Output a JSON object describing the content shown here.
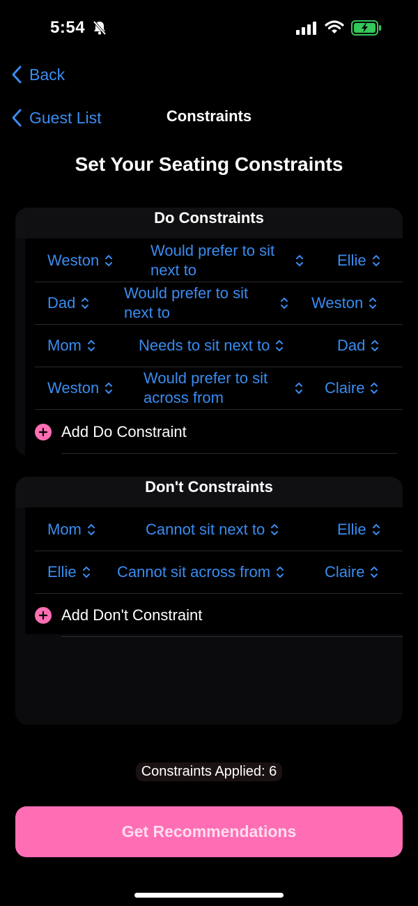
{
  "status_bar": {
    "time": "5:54",
    "icons": [
      "bell-slash-icon",
      "cellular-signal-icon",
      "wifi-icon",
      "battery-charging-icon"
    ],
    "battery_color": "#34c759"
  },
  "nav": {
    "back_label": "Back",
    "guest_list_label": "Guest List",
    "title": "Constraints"
  },
  "heading": "Set Your Seating Constraints",
  "do_section": {
    "title": "Do Constraints",
    "rows": [
      {
        "guest_a": "Weston",
        "relation": "Would prefer to sit next to",
        "guest_b": "Ellie"
      },
      {
        "guest_a": "Dad",
        "relation": "Would prefer to sit next to",
        "guest_b": "Weston"
      },
      {
        "guest_a": "Mom",
        "relation": "Needs to sit next to",
        "guest_b": "Dad"
      },
      {
        "guest_a": "Weston",
        "relation": "Would prefer to sit across from",
        "guest_b": "Claire"
      }
    ],
    "add_label": "Add Do Constraint"
  },
  "dont_section": {
    "title": "Don't Constraints",
    "rows": [
      {
        "guest_a": "Mom",
        "relation": "Cannot sit next to",
        "guest_b": "Ellie"
      },
      {
        "guest_a": "Ellie",
        "relation": "Cannot sit across from",
        "guest_b": "Claire"
      }
    ],
    "add_label": "Add Don't Constraint"
  },
  "constraints_applied": "Constraints Applied: 6",
  "cta_label": "Get Recommendations",
  "colors": {
    "accent_blue": "#3a8cf0",
    "accent_pink": "#ff6eb5",
    "background": "#000000"
  }
}
